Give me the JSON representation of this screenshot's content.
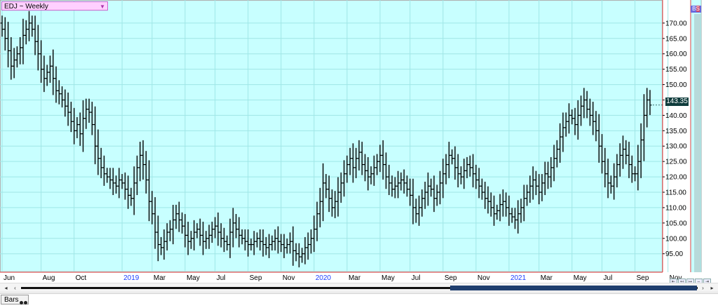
{
  "header": {
    "symbol_label": "EDJ ~ Weekly",
    "badge_left": "B",
    "badge_right": "S"
  },
  "last_price_label": "143.35",
  "tab": {
    "label": "Bars"
  },
  "colors": {
    "plot_bg": "#c8ffff",
    "grid": "#9fe6e6",
    "bars": "#000000",
    "axis_line": "#e04040",
    "year_label": "#2040ff",
    "last_price_bg": "#0f3c3c"
  },
  "chart_data": {
    "type": "bar",
    "subtype": "ohlc",
    "title": "",
    "ylim": [
      89.0,
      177.5
    ],
    "yticks": [
      "95.00",
      "100.00",
      "105.00",
      "110.00",
      "115.00",
      "120.00",
      "125.00",
      "130.00",
      "135.00",
      "140.00",
      "145.00",
      "150.00",
      "155.00",
      "160.00",
      "165.00",
      "170.00"
    ],
    "ytick_values": [
      95,
      100,
      105,
      110,
      115,
      120,
      125,
      130,
      135,
      140,
      145,
      150,
      155,
      160,
      165,
      170
    ],
    "grid": true,
    "last_price": 143.35,
    "x_labels": [
      {
        "text": "Jun",
        "bar": 0,
        "year": false
      },
      {
        "text": "Aug",
        "bar": 13,
        "year": false
      },
      {
        "text": "Oct",
        "bar": 24,
        "year": false
      },
      {
        "text": "2019",
        "bar": 40,
        "year": true
      },
      {
        "text": "Mar",
        "bar": 50,
        "year": false
      },
      {
        "text": "May",
        "bar": 61,
        "year": false
      },
      {
        "text": "Jul",
        "bar": 71,
        "year": false
      },
      {
        "text": "Sep",
        "bar": 82,
        "year": false
      },
      {
        "text": "Nov",
        "bar": 93,
        "year": false
      },
      {
        "text": "2020",
        "bar": 104,
        "year": true
      },
      {
        "text": "Mar",
        "bar": 115,
        "year": false
      },
      {
        "text": "May",
        "bar": 126,
        "year": false
      },
      {
        "text": "Jul",
        "bar": 136,
        "year": false
      },
      {
        "text": "Sep",
        "bar": 147,
        "year": false
      },
      {
        "text": "Nov",
        "bar": 158,
        "year": false
      },
      {
        "text": "2021",
        "bar": 169,
        "year": true
      },
      {
        "text": "Mar",
        "bar": 179,
        "year": false
      },
      {
        "text": "May",
        "bar": 190,
        "year": false
      },
      {
        "text": "Jul",
        "bar": 200,
        "year": false
      },
      {
        "text": "Sep",
        "bar": 211,
        "year": false
      },
      {
        "text": "Nov",
        "bar": 222,
        "year": false
      },
      {
        "text": "2022",
        "bar": 233,
        "year": true
      }
    ],
    "closes": [
      168,
      165,
      161,
      156,
      158,
      160,
      162,
      166,
      168,
      170,
      168,
      164,
      160,
      155,
      152,
      154,
      156,
      152,
      148,
      147,
      145,
      143,
      141,
      138,
      135,
      137,
      134,
      139,
      142,
      141,
      137,
      130,
      126,
      123,
      121,
      120,
      119,
      118,
      117,
      119,
      118,
      116,
      114,
      113,
      118,
      123,
      127,
      124,
      119,
      112,
      108,
      102,
      98,
      97,
      99,
      102,
      103,
      106,
      108,
      106,
      104,
      101,
      99,
      100,
      102,
      103,
      101,
      99,
      100,
      101,
      103,
      104,
      102,
      100,
      99,
      98,
      102,
      105,
      103,
      101,
      100,
      99,
      98,
      98,
      99,
      100,
      99,
      98,
      97,
      98,
      99,
      100,
      99,
      98,
      97,
      98,
      99,
      96,
      95,
      94,
      95,
      97,
      98,
      100,
      103,
      108,
      112,
      118,
      116,
      113,
      110,
      112,
      115,
      118,
      121,
      124,
      126,
      123,
      126,
      128,
      124,
      122,
      120,
      121,
      123,
      125,
      127,
      124,
      120,
      118,
      116,
      117,
      118,
      119,
      118,
      116,
      114,
      110,
      108,
      110,
      113,
      115,
      117,
      116,
      113,
      115,
      118,
      121,
      124,
      127,
      126,
      123,
      121,
      120,
      122,
      124,
      123,
      121,
      119,
      117,
      115,
      113,
      112,
      110,
      108,
      109,
      111,
      112,
      110,
      108,
      107,
      106,
      108,
      110,
      113,
      115,
      117,
      119,
      117,
      115,
      118,
      121,
      120,
      123,
      126,
      129,
      133,
      136,
      138,
      140,
      139,
      137,
      140,
      143,
      145,
      142,
      140,
      138,
      135,
      130,
      125,
      121,
      118,
      117,
      120,
      124,
      127,
      129,
      127,
      124,
      121,
      121,
      125,
      132,
      140,
      145,
      143.35
    ]
  }
}
